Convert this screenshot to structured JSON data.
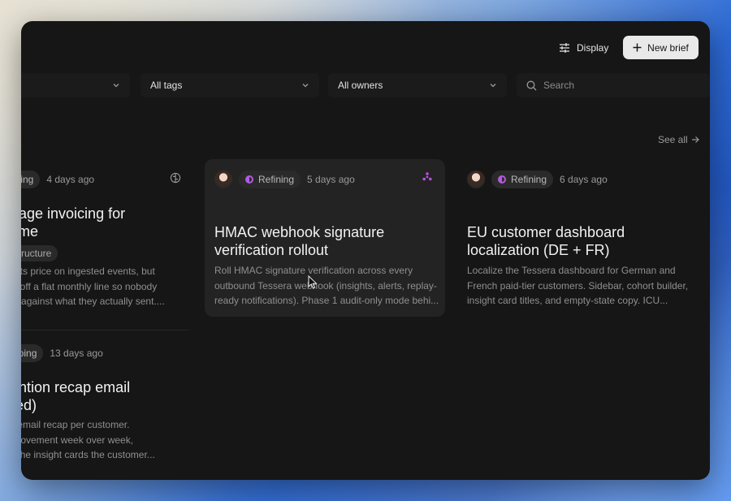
{
  "toolbar": {
    "display_label": "Display",
    "new_brief_label": "New brief"
  },
  "filters": {
    "first": "",
    "tags": "All tags",
    "owners": "All owners",
    "search_placeholder": "Search"
  },
  "section": {
    "count_fragment": ")",
    "see_all": "See all"
  },
  "cards": [
    {
      "status": "ining",
      "age": "4 days ago",
      "title_lines": [
        "-usage invoicing for",
        "plume"
      ],
      "tag": "rastructure",
      "desc_lines": [
        "ntracts price on ingested events, but",
        "runs off a flat monthly line so nobody",
        "a bill against what they actually sent...."
      ]
    },
    {
      "status": "Refining",
      "age": "5 days ago",
      "title_lines": [
        "HMAC webhook signature",
        "verification rollout"
      ],
      "desc_lines": [
        "Roll HMAC signature verification across every",
        "outbound Tessera webhook (insights, alerts, replay-",
        "ready notifications). Phase 1 audit-only mode behi..."
      ]
    },
    {
      "status": "Refining",
      "age": "6 days ago",
      "title_lines": [
        "EU customer dashboard",
        "localization (DE + FR)"
      ],
      "desc_lines": [
        "Localize the Tessera dashboard for German and",
        "French paid-tier customers. Sidebar, cohort builder,",
        "insight card titles, and empty-state copy. ICU..."
      ]
    },
    {
      "status": "pping",
      "age": "13 days ago",
      "title_lines": [
        "etention recap email",
        "rated)"
      ],
      "desc_lines": [
        "tten email recap per customer.",
        "ort movement week over week,",
        "and the insight cards the customer..."
      ]
    }
  ],
  "colors": {
    "accent_status": "#b25ae0",
    "window_bg": "#161616",
    "button_bg": "#e9e9e9"
  }
}
